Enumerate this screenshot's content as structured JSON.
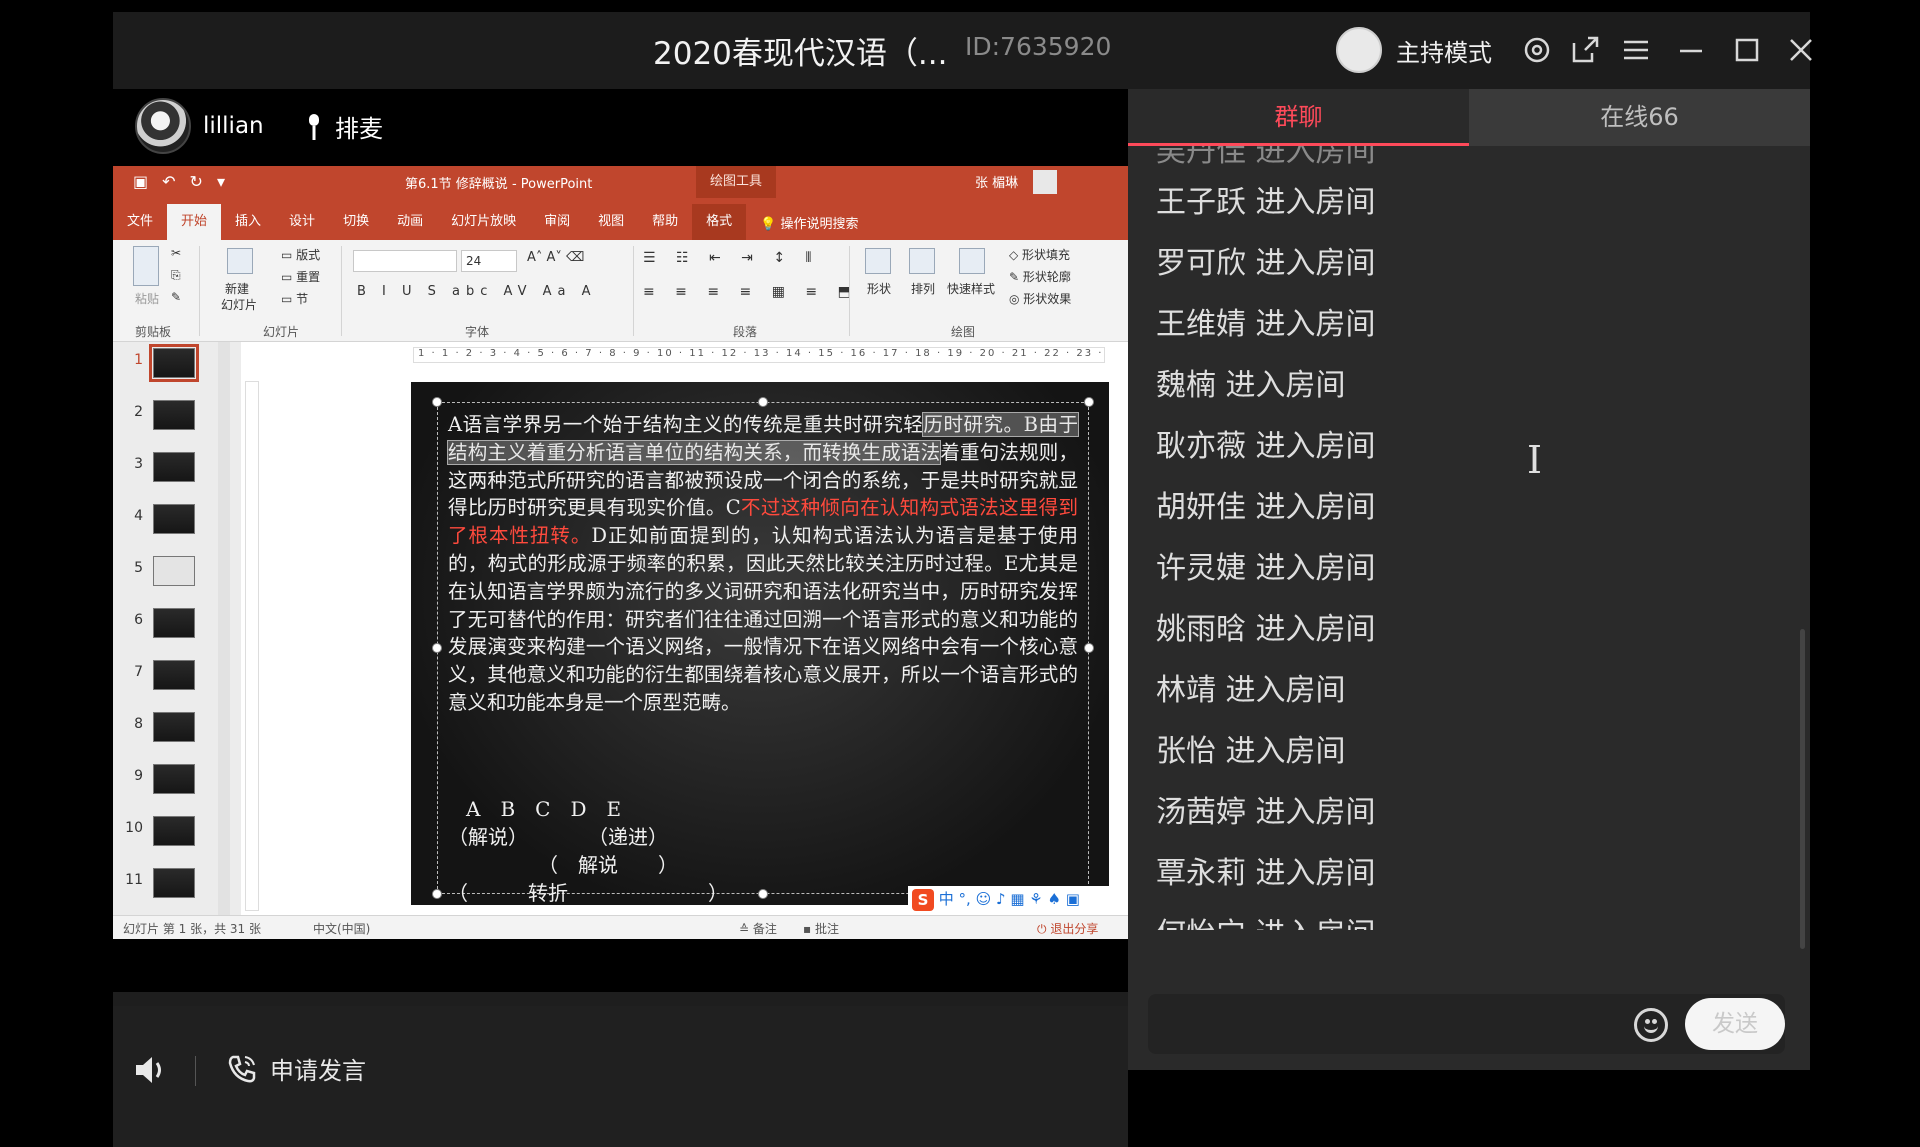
{
  "window": {
    "title": "2020春现代汉语（...",
    "id": "ID:7635920",
    "host_mode": "主持模式",
    "icons": [
      "settings-icon",
      "popout-icon",
      "menu-icon",
      "minimize-icon",
      "maximize-icon",
      "close-icon"
    ]
  },
  "presenter": {
    "name": "lillian",
    "mic_queue": "排麦"
  },
  "ppt": {
    "doc_title": "第6.1节 修辞概说 - PowerPoint",
    "drawing_tools": "绘图工具",
    "user": "张 楣琳",
    "tabs": [
      "文件",
      "开始",
      "插入",
      "设计",
      "切换",
      "动画",
      "幻灯片放映",
      "审阅",
      "视图",
      "帮助",
      "格式"
    ],
    "active_tab": "开始",
    "tell_me": "操作说明搜索",
    "ribbon": {
      "groups": [
        "剪贴板",
        "幻灯片",
        "字体",
        "段落",
        "绘图"
      ],
      "paste": "粘贴",
      "new_slide_1": "新建",
      "new_slide_2": "幻灯片",
      "layout": "版式",
      "reset": "重置",
      "section": "节",
      "font_size": "24",
      "shape": "形状",
      "arrange": "排列",
      "quick_styles": "快速样式",
      "shape_fill": "形状填充",
      "shape_outline": "形状轮廓",
      "shape_effects": "形状效果"
    },
    "ruler": "1 · 1 · 2 · 3 · 4 · 5 · 6 · 7 · 8 · 9 · 10 · 11 · 12 · 13 · 14 · 15 · 16 · 17 · 18 · 19 · 20 · 21 · 22 · 23 · 24",
    "thumbnails": [
      "1",
      "2",
      "3",
      "4",
      "5",
      "6",
      "7",
      "8",
      "9",
      "10",
      "11"
    ],
    "slide": {
      "p_a": "A语言学界另一个始于结构主义的传统是重共时研究轻",
      "p_hl1": "历时研究。B由于结构主义着重分析语言单位的结构关系，而转换生成语法",
      "p_b": "着重句法规则，这两种范式所研究的语言都被预设成一个闭合的系统，于是共时研究就显得比历时研究更具有现实价值。C",
      "p_red": "不过这种倾向在认知构式语法这里得到了根本性扭转。",
      "p_c": "D正如前面提到的，认知构式语法认为语言是基于使用的，构式的形成源于频率的积累，因此天然比较关注历时过程。E尤其是在认知语言学界颇为流行的多义词研究和语法化研究当中，历时研究发挥了无可替代的作用：研究者们往往通过回溯一个语言形式的意义和功能的发展演变来构建一个语义网络，一般情况下在语义网络中会有一个核心意义，其他意义和功能的衍生都围绕着核心意义展开，所以一个语言形式的意义和功能本身是一个原型范畴。",
      "opt_letters": "A　B　C　D　E",
      "opt_line1": "（解说）　　　　（递进）",
      "opt_line2": "（　解说　　）",
      "opt_line3": "（　　　转折　　　　　　　）"
    },
    "status": {
      "slide_info": "幻灯片 第 1 张，共 31 张",
      "lang": "中文(中国)",
      "notes": "备注",
      "comments": "批注",
      "exit_share": "退出分享",
      "ime": "中 °, ☺ ♪ ▦ ⚘ ♠ ▣"
    }
  },
  "bottom": {
    "request_speak": "申请发言"
  },
  "panel": {
    "tabs": [
      "群聊",
      "在线66"
    ],
    "active_tab": "群聊",
    "partial_top": "吴丹佳 进入房间",
    "messages": [
      "王子跃 进入房间",
      "罗可欣 进入房间",
      "王维婧 进入房间",
      "魏楠 进入房间",
      "耿亦薇 进入房间",
      "胡妍佳 进入房间",
      "许灵婕 进入房间",
      "姚雨晗 进入房间",
      "林靖 进入房间",
      "张怡 进入房间",
      "汤茜婷 进入房间",
      "覃永莉 进入房间",
      "何怡宁 进入房间"
    ],
    "send": "发送"
  }
}
